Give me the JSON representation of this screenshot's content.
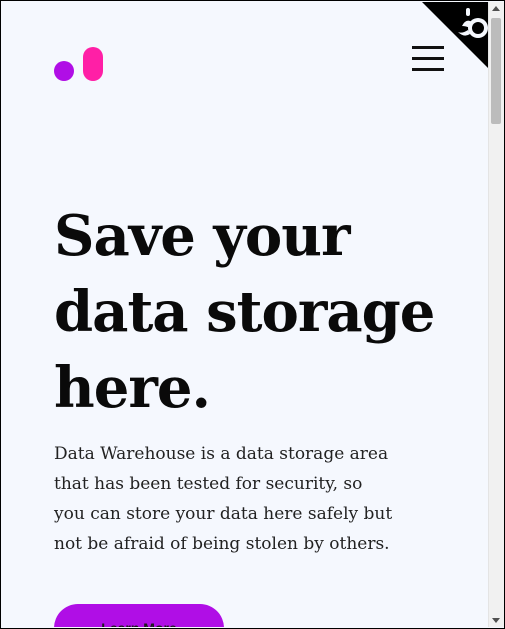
{
  "brand": {
    "logo_icon": "logo-icon",
    "dot_color": "#b00ee6",
    "bar_color": "#ff1fa6"
  },
  "header": {
    "menu_icon": "hamburger-menu-icon",
    "corner_icon": "github-corner-icon"
  },
  "hero": {
    "title_lines": [
      "Save your",
      "data storage",
      "here."
    ],
    "description": "Data Warehouse is a data storage area that has been tested for security, so you can store your data here safely but not be afraid of being stolen by others.",
    "cta_label": "Learn More"
  },
  "colors": {
    "background": "#f5f8fe",
    "accent": "#b00ee6",
    "text": "#0a0a0a"
  }
}
